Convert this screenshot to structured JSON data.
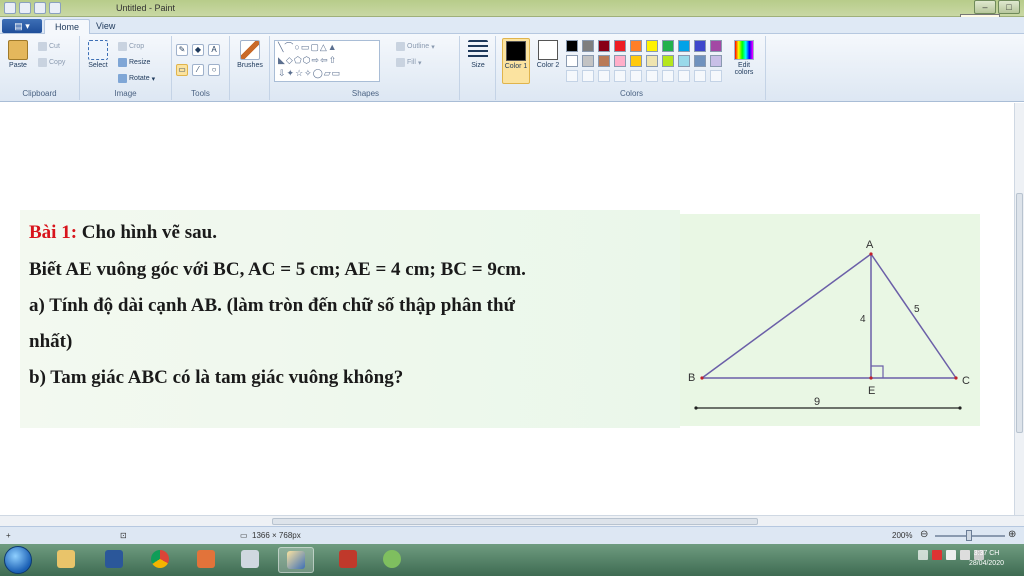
{
  "window": {
    "title": "Untitled - Paint",
    "tooltip": "Minimize"
  },
  "tabs": {
    "home": "Home",
    "view": "View"
  },
  "ribbon": {
    "clipboard": {
      "label": "Clipboard",
      "paste": "Paste",
      "cut": "Cut",
      "copy": "Copy"
    },
    "image": {
      "label": "Image",
      "select": "Select",
      "crop": "Crop",
      "resize": "Resize",
      "rotate": "Rotate"
    },
    "tools": {
      "label": "Tools"
    },
    "brushes": {
      "label": "Brushes"
    },
    "shapes": {
      "label": "Shapes",
      "outline": "Outline",
      "fill": "Fill"
    },
    "size": {
      "label": "Size"
    },
    "colors": {
      "label": "Colors",
      "color1": "Color 1",
      "color2": "Color 2",
      "edit": "Edit colors",
      "palette_row1": [
        "#000000",
        "#7f7f7f",
        "#880015",
        "#ed1c24",
        "#ff7f27",
        "#fff200",
        "#22b14c",
        "#00a2e8",
        "#3f48cc",
        "#a349a4"
      ],
      "palette_row2": [
        "#ffffff",
        "#c3c3c3",
        "#b97a57",
        "#ffaec9",
        "#ffc90e",
        "#efe4b0",
        "#b5e61d",
        "#99d9ea",
        "#7092be",
        "#c8bfe7"
      ]
    }
  },
  "problem": {
    "line1_title": "Bài 1:",
    "line1_text": " Cho  hình  vẽ sau.",
    "line2": "Biết AE vuông  góc với BC, AC = 5 cm; AE = 4 cm; BC = 9cm.",
    "line3": "a) Tính độ dài cạnh AB. (làm tròn đến chữ số thập phân  thứ",
    "line4": "nhất)",
    "line5": "b)  Tam giác ABC có là tam giác vuông  không?"
  },
  "figure": {
    "labels": {
      "A": "A",
      "B": "B",
      "C": "C",
      "E": "E",
      "ae": "4",
      "ac": "5",
      "bc": "9"
    }
  },
  "status": {
    "dimensions": "1366 × 768px",
    "zoom": "200%"
  },
  "taskbar": {
    "clock_time": "3:37 CH",
    "clock_date": "28/04/2020"
  }
}
